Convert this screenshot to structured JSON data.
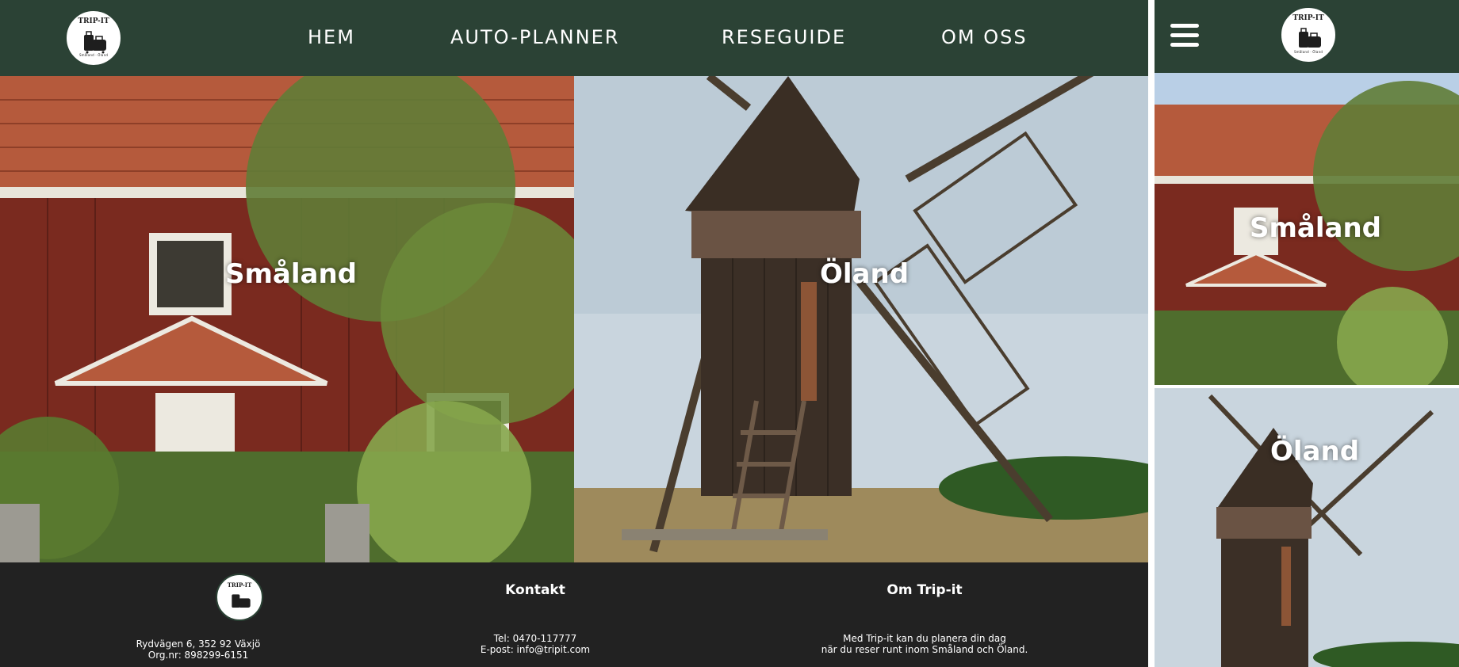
{
  "brand": {
    "logo_text": "TRIP-IT",
    "logo_sub": "Småland · Öland"
  },
  "nav": [
    {
      "label": "HEM"
    },
    {
      "label": "AUTO-PLANNER"
    },
    {
      "label": "RESEGUIDE"
    },
    {
      "label": "OM OSS"
    }
  ],
  "regions": [
    {
      "title": "Småland"
    },
    {
      "title": "Öland"
    }
  ],
  "footer": {
    "address": "Rydvägen 6, 352 92 Växjö",
    "orgnr": "Org.nr: 898299-6151",
    "contact": {
      "heading": "Kontakt",
      "phone": "Tel: 0470-117777",
      "email": "E-post: info@tripit.com"
    },
    "about": {
      "heading": "Om Trip-it",
      "line1": "Med Trip-it kan du planera din dag",
      "line2": "när du reser runt inom Småland och Öland."
    }
  },
  "mobile": {
    "menu_icon": "hamburger-menu-icon"
  },
  "colors": {
    "nav_bg": "#2b4235",
    "footer_bg": "#222222",
    "text": "#ffffff"
  }
}
